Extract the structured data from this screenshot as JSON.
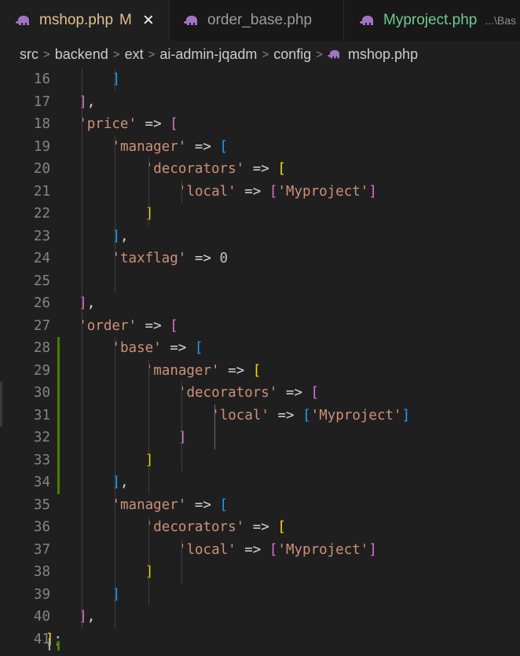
{
  "tabs": [
    {
      "label": "mshop.php",
      "badge": "M",
      "close": "×",
      "description": ""
    },
    {
      "label": "order_base.php",
      "badge": "",
      "close": "",
      "description": ""
    },
    {
      "label": "Myproject.php",
      "badge": "",
      "close": "",
      "description": "...\\Bas"
    }
  ],
  "breadcrumb": [
    "src",
    "backend",
    "ext",
    "ai-admin-jqadm",
    "config",
    "mshop.php"
  ],
  "breadcrumb_sep": ">",
  "colors": {
    "string": "#ce9178",
    "punctuation": "#d4d4d4",
    "number": "#b5cea8",
    "bracket_level_1": "#ffd700",
    "bracket_level_2": "#da70d6",
    "bracket_level_3": "#179fff",
    "line_number": "#858585",
    "modified_gutter": "#487e02",
    "php_icon": "#a074c4"
  },
  "lines": [
    {
      "num": "16",
      "indent": 4,
      "tokens": [
        {
          "t": "]",
          "c": "b3"
        }
      ]
    },
    {
      "num": "17",
      "indent": 2,
      "tokens": [
        {
          "t": "]",
          "c": "b2"
        },
        {
          "t": ",",
          "c": "p"
        }
      ]
    },
    {
      "num": "18",
      "indent": 2,
      "tokens": [
        {
          "t": "'price'",
          "c": "s"
        },
        {
          "t": " => ",
          "c": "p"
        },
        {
          "t": "[",
          "c": "b2"
        }
      ]
    },
    {
      "num": "19",
      "indent": 4,
      "tokens": [
        {
          "t": "'manager'",
          "c": "s"
        },
        {
          "t": " => ",
          "c": "p"
        },
        {
          "t": "[",
          "c": "b3"
        }
      ]
    },
    {
      "num": "20",
      "indent": 6,
      "tokens": [
        {
          "t": "'decorators'",
          "c": "s"
        },
        {
          "t": " => ",
          "c": "p"
        },
        {
          "t": "[",
          "c": "b1"
        }
      ]
    },
    {
      "num": "21",
      "indent": 8,
      "tokens": [
        {
          "t": "'local'",
          "c": "s"
        },
        {
          "t": " => ",
          "c": "p"
        },
        {
          "t": "[",
          "c": "b2"
        },
        {
          "t": "'Myproject'",
          "c": "s"
        },
        {
          "t": "]",
          "c": "b2"
        }
      ]
    },
    {
      "num": "22",
      "indent": 6,
      "tokens": [
        {
          "t": "]",
          "c": "b1"
        }
      ]
    },
    {
      "num": "23",
      "indent": 4,
      "tokens": [
        {
          "t": "]",
          "c": "b3"
        },
        {
          "t": ",",
          "c": "p"
        }
      ]
    },
    {
      "num": "24",
      "indent": 4,
      "tokens": [
        {
          "t": "'taxflag'",
          "c": "s"
        },
        {
          "t": " => ",
          "c": "p"
        },
        {
          "t": "0",
          "c": "n"
        }
      ]
    },
    {
      "num": "25",
      "indent": 0,
      "tokens": []
    },
    {
      "num": "26",
      "indent": 2,
      "tokens": [
        {
          "t": "]",
          "c": "b2"
        },
        {
          "t": ",",
          "c": "p"
        }
      ]
    },
    {
      "num": "27",
      "indent": 2,
      "tokens": [
        {
          "t": "'order'",
          "c": "s"
        },
        {
          "t": " => ",
          "c": "p"
        },
        {
          "t": "[",
          "c": "b2"
        }
      ]
    },
    {
      "num": "28",
      "indent": 4,
      "tokens": [
        {
          "t": "'base'",
          "c": "s"
        },
        {
          "t": " => ",
          "c": "p"
        },
        {
          "t": "[",
          "c": "b3"
        }
      ]
    },
    {
      "num": "29",
      "indent": 6,
      "tokens": [
        {
          "t": "'manager'",
          "c": "s"
        },
        {
          "t": " => ",
          "c": "p"
        },
        {
          "t": "[",
          "c": "b1"
        }
      ]
    },
    {
      "num": "30",
      "indent": 8,
      "tokens": [
        {
          "t": "'decorators'",
          "c": "s"
        },
        {
          "t": " => ",
          "c": "p"
        },
        {
          "t": "[",
          "c": "b2"
        }
      ]
    },
    {
      "num": "31",
      "indent": 10,
      "tokens": [
        {
          "t": "'local'",
          "c": "s"
        },
        {
          "t": " => ",
          "c": "p"
        },
        {
          "t": "[",
          "c": "b3"
        },
        {
          "t": "'Myproject'",
          "c": "s"
        },
        {
          "t": "]",
          "c": "b3"
        }
      ]
    },
    {
      "num": "32",
      "indent": 8,
      "tokens": [
        {
          "t": "]",
          "c": "b2"
        }
      ]
    },
    {
      "num": "33",
      "indent": 6,
      "tokens": [
        {
          "t": "]",
          "c": "b1"
        }
      ]
    },
    {
      "num": "34",
      "indent": 4,
      "tokens": [
        {
          "t": "]",
          "c": "b3"
        },
        {
          "t": ",",
          "c": "p"
        }
      ]
    },
    {
      "num": "35",
      "indent": 4,
      "tokens": [
        {
          "t": "'manager'",
          "c": "s"
        },
        {
          "t": " => ",
          "c": "p"
        },
        {
          "t": "[",
          "c": "b3"
        }
      ]
    },
    {
      "num": "36",
      "indent": 6,
      "tokens": [
        {
          "t": "'decorators'",
          "c": "s"
        },
        {
          "t": " => ",
          "c": "p"
        },
        {
          "t": "[",
          "c": "b1"
        }
      ]
    },
    {
      "num": "37",
      "indent": 8,
      "tokens": [
        {
          "t": "'local'",
          "c": "s"
        },
        {
          "t": " => ",
          "c": "p"
        },
        {
          "t": "[",
          "c": "b2"
        },
        {
          "t": "'Myproject'",
          "c": "s"
        },
        {
          "t": "]",
          "c": "b2"
        }
      ]
    },
    {
      "num": "38",
      "indent": 6,
      "tokens": [
        {
          "t": "]",
          "c": "b1"
        }
      ]
    },
    {
      "num": "39",
      "indent": 4,
      "tokens": [
        {
          "t": "]",
          "c": "b3"
        }
      ]
    },
    {
      "num": "40",
      "indent": 2,
      "tokens": [
        {
          "t": "]",
          "c": "b2"
        },
        {
          "t": ",",
          "c": "p"
        }
      ]
    },
    {
      "num": "41",
      "indent": 0,
      "tokens": [
        {
          "t": "]",
          "c": "b1"
        },
        {
          "t": ";",
          "c": "p"
        }
      ]
    }
  ]
}
